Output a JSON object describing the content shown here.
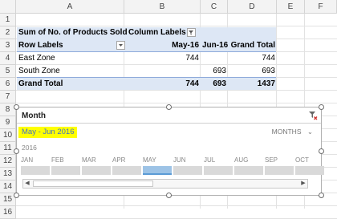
{
  "columns": [
    "A",
    "B",
    "C",
    "D",
    "E",
    "F"
  ],
  "rows": [
    "1",
    "2",
    "3",
    "4",
    "5",
    "6",
    "7",
    "8",
    "9",
    "10",
    "11",
    "12",
    "13",
    "14",
    "15",
    "16"
  ],
  "pivot": {
    "header_values": "Sum of No. of Products Sold",
    "header_columns": "Column Labels",
    "row_labels": "Row Labels",
    "col_may": "May-16",
    "col_jun": "Jun-16",
    "col_total": "Grand Total",
    "rows": [
      {
        "label": "East Zone",
        "may": "744",
        "jun": "",
        "total": "744"
      },
      {
        "label": "South Zone",
        "may": "",
        "jun": "693",
        "total": "693"
      }
    ],
    "grand_label": "Grand Total",
    "grand_may": "744",
    "grand_jun": "693",
    "grand_total": "1437"
  },
  "slicer": {
    "title": "Month",
    "selection": "May - Jun 2016",
    "level": "MONTHS",
    "year": "2016",
    "months": [
      "JAN",
      "FEB",
      "MAR",
      "APR",
      "MAY",
      "JUN",
      "JUL",
      "AUG",
      "SEP",
      "OCT"
    ],
    "selected": [
      "MAY"
    ]
  },
  "colors": {
    "pivot_fill": "#dde7f5",
    "highlight": "#ffff00",
    "selected_bar": "#9dc3e6",
    "accent": "#4472c4"
  }
}
